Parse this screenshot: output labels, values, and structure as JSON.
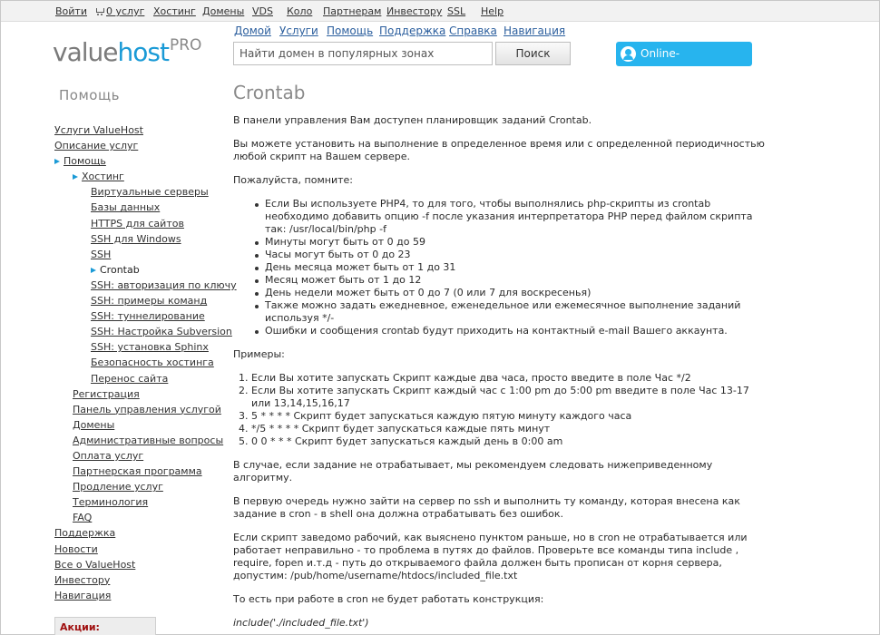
{
  "topbar": {
    "login": "Войти",
    "cart": "0 услуг",
    "hosting": "Хостинг",
    "domains": "Домены",
    "vds": "VDS",
    "colo": "Коло",
    "partners": "Партнерам",
    "investors": "Инвестору",
    "ssl": "SSL",
    "help": "Help"
  },
  "logo": {
    "part1": "value",
    "part2": "host",
    "sup": "PRO"
  },
  "nav": {
    "home": "Домой",
    "services": "Услуги",
    "help": "Помощь",
    "support": "Поддержка",
    "reference": "Справка",
    "navigation": "Навигация"
  },
  "search": {
    "value": "Найти домен в популярных зонах",
    "button": "Поиск"
  },
  "consultant": {
    "label": "Online-консультант",
    "icon": "user-chat-icon",
    "color": "#27b4ee"
  },
  "sidebar": {
    "title": "Помощь",
    "items": [
      {
        "label": "Услуги ValueHost"
      },
      {
        "label": "Описание услуг"
      },
      {
        "label": "Помощь"
      },
      {
        "label": "Хостинг"
      },
      {
        "label": "Виртуальные серверы"
      },
      {
        "label": "Базы данных"
      },
      {
        "label": "HTTPS для сайтов"
      },
      {
        "label": "SSH для Windows"
      },
      {
        "label": "SSH"
      },
      {
        "label": "Crontab"
      },
      {
        "label": "SSH: авторизация по ключу"
      },
      {
        "label": "SSH: примеры команд"
      },
      {
        "label": "SSH: туннелирование"
      },
      {
        "label": "SSH: Настройка Subversion"
      },
      {
        "label": "SSH: установка Sphinx"
      },
      {
        "label": "Безопасность хостинга"
      },
      {
        "label": "Перенос сайта"
      },
      {
        "label": "Регистрация"
      },
      {
        "label": "Панель управления услугой"
      },
      {
        "label": "Домены"
      },
      {
        "label": "Административные вопросы"
      },
      {
        "label": "Оплата услуг"
      },
      {
        "label": "Партнерская программа"
      },
      {
        "label": "Продление услуг"
      },
      {
        "label": "Терминология"
      },
      {
        "label": "FAQ"
      },
      {
        "label": "Поддержка"
      },
      {
        "label": "Новости"
      },
      {
        "label": "Все о ValueHost"
      },
      {
        "label": "Инвестору"
      },
      {
        "label": "Навигация"
      }
    ],
    "promo": "Акции:"
  },
  "content": {
    "title": "Crontab",
    "p1": "В панели управления Вам доступен планировщик заданий Crontab.",
    "p2": "Вы можете установить на выполнение в определенное время или с определенной периодичностью любой скрипт на Вашем сервере.",
    "p3": "Пожалуйста, помните:",
    "bullets": [
      "Если Вы используете PHP4, то для того, чтобы выполнялись php-скрипты из crontab необходимо добавить опцию -f после указания интерпретатора PHP перед файлом скрипта так: /usr/local/bin/php -f",
      "Минуты могут быть от 0 до 59",
      "Часы могут быть от 0 до 23",
      "День месяца может быть от 1 до 31",
      "Месяц может быть от 1 до 12",
      "День недели может быть от 0 до 7 (0 или 7 для воскресенья)",
      "Также можно задать ежедневное, еженедельное или ежемесячное выполнение заданий используя */-",
      "Ошибки и сообщения crontab будут приходить на контактный e-mail Вашего аккаунта."
    ],
    "p4": "Примеры:",
    "examples": [
      "Если Вы хотите запускать Скрипт каждые два часа, просто введите в поле Час */2",
      "Если Вы хотите запускать Скрипт каждый час с 1:00 pm до 5:00 pm введите в поле Час 13-17 или 13,14,15,16,17",
      "5 * * * * Скрипт будет запускаться каждую пятую минуту каждого часа",
      "*/5 * * * * Скрипт будет запускаться каждые пять минут",
      "0 0 * * * Скрипт будет запускаться каждый день в 0:00 am"
    ],
    "p5": "В случае, если задание не отрабатывает, мы рекомендуем следовать нижеприведенному алгоритму.",
    "p6": "В первую очередь нужно зайти на сервер по ssh и выполнить ту команду, которая внесена как задание в cron - в shell она должна отрабатывать без ошибок.",
    "p7": "Если скрипт заведомо рабочий, как выяснено пунктом раньше, но в cron не отрабатывается или работает неправильно - то проблема в путях до файлов. Проверьте все команды типа include , require, fopen и.т.д - путь до открываемого файла должен быть прописан от корня сервера, допустим: /pub/home/username/htdocs/included_file.txt",
    "p8": "То есть при работе в cron не будет работать конструкция:",
    "code": "include('./included_file.txt')"
  }
}
